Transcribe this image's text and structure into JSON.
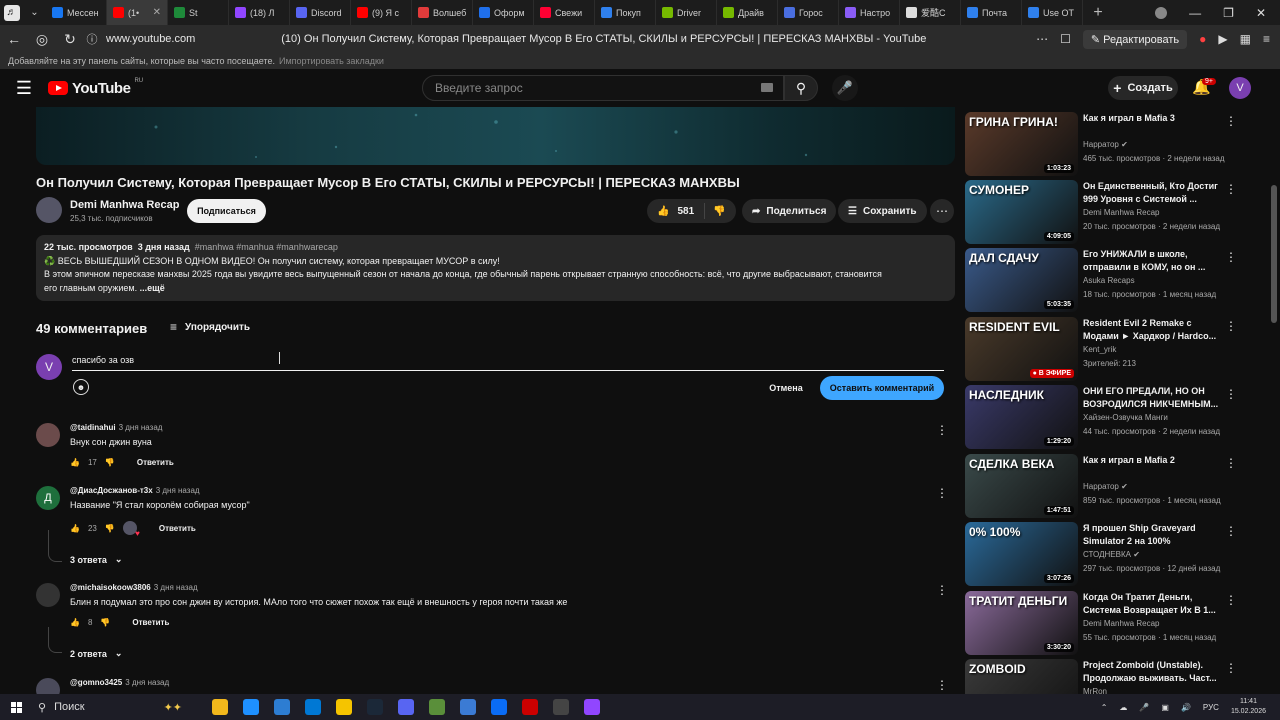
{
  "browser": {
    "tabs": [
      {
        "label": "Мессен",
        "color": "#1877f2"
      },
      {
        "label": "(1•",
        "color": "#ff0000",
        "active": true
      },
      {
        "label": "St",
        "color": "#1e8a3a"
      },
      {
        "label": "(18) Л",
        "color": "#9146ff"
      },
      {
        "label": "Discord",
        "color": "#5865f2"
      },
      {
        "label": "(9) Я с",
        "color": "#ff0000"
      },
      {
        "label": "Волшеб",
        "color": "#e23b3b"
      },
      {
        "label": "Оформ",
        "color": "#1f6feb"
      },
      {
        "label": "Свежи",
        "color": "#ff0033"
      },
      {
        "label": "Покуп",
        "color": "#2f80ed"
      },
      {
        "label": "Driver",
        "color": "#76b900"
      },
      {
        "label": "Драйв",
        "color": "#76b900"
      },
      {
        "label": "Горос",
        "color": "#4a6ee0"
      },
      {
        "label": "Настро",
        "color": "#8a5cf6"
      },
      {
        "label": "爱酷C",
        "color": "#dddddd"
      },
      {
        "label": "Почта",
        "color": "#2f80ed"
      },
      {
        "label": "Use OT",
        "color": "#2f80ed"
      }
    ],
    "url": "www.youtube.com",
    "page_title": "(10) Он Получил Систему, Которая Превращает Мусор В Его СТАТЫ, СКИЛЫ и РЕРСУРСЫ! | ПЕРЕСКАЗ МАНХВЫ - YouTube",
    "edit_label": "Редактировать",
    "bookmarks_hint": "Добавляйте на эту панель сайты, которые вы часто посещаете.",
    "bookmarks_import": "Импортировать закладки"
  },
  "youtube": {
    "logo_text": "YouTube",
    "region": "RU",
    "search_placeholder": "Введите запрос",
    "create_label": "Создать",
    "notif_count": "9+",
    "avatar_letter": "V"
  },
  "video": {
    "title": "Он Получил Систему, Которая Превращает Мусор В Его СТАТЫ, СКИЛЫ и РЕРСУРСЫ! | ПЕРЕСКАЗ МАНХВЫ",
    "channel": "Demi Manhwa Recap",
    "subs": "25,3 тыс. подписчиков",
    "subscribe": "Подписаться",
    "likes": "581",
    "share": "Поделиться",
    "save": "Сохранить",
    "desc_views": "22 тыс. просмотров",
    "desc_date": "3 дня назад",
    "desc_tags": "#manhwa #manhua #manhwarecap",
    "desc_line1": "♻️ ВЕСЬ ВЫШЕДШИЙ СЕЗОН В ОДНОМ ВИДЕО! Он получил систему, которая превращает МУСОР в силу!",
    "desc_line2": "В этом эпичном пересказе манхвы 2025 года вы увидите весь выпущенный сезон от начала до конца, где обычный парень открывает странную способность: всё, что другие выбрасывают, становится",
    "desc_line3": "его главным оружием.",
    "desc_more": "...ещё"
  },
  "comments": {
    "count_label": "49 комментариев",
    "sort_label": "Упорядочить",
    "my_avatar": "V",
    "draft": "спасибо за озв",
    "cancel": "Отмена",
    "submit": "Оставить комментарий",
    "items": [
      {
        "author": "@taidinahui",
        "time": "3 дня назад",
        "text": "Внук сон джин вуна",
        "likes": "17",
        "reply": "Ответить",
        "avatar_letter": "",
        "avatar_color": "#6b4b4b"
      },
      {
        "author": "@ДиасДосжанов-т3х",
        "time": "3 дня назад",
        "text": "Название \"Я стал королём собирая мусор\"",
        "likes": "23",
        "reply": "Ответить",
        "avatar_letter": "Д",
        "avatar_color": "#1e6f3c",
        "replies": "3 ответа"
      },
      {
        "author": "@michaisokoow3806",
        "time": "3 дня назад",
        "text": "Блин я подумал это про сон джин ву история. МАло того что сюжет похож так ещё и внешность у героя почти такая же",
        "likes": "8",
        "reply": "Ответить",
        "avatar_letter": "",
        "avatar_color": "#333333",
        "replies": "2 ответа"
      },
      {
        "author": "@gomno3425",
        "time": "3 дня назад",
        "avatar_letter": "",
        "avatar_color": "#4a4a5a"
      }
    ]
  },
  "recommendations": [
    {
      "title": "Как я играл в Mafia 3",
      "channel": "Нарратор",
      "meta": "465 тыс. просмотров · 2 недели назад",
      "duration": "1:03:23",
      "verified": true,
      "thumb_text": "ГРИНА ГРИНА!",
      "thumb_color": "#5a3a2a"
    },
    {
      "title": "Он Единственный, Кто Достиг 999 Уровня с Системой ...",
      "channel": "Demi Manhwa Recap",
      "meta": "20 тыс. просмотров · 2 недели назад",
      "duration": "4:09:05",
      "thumb_text": "СУМОНЕР",
      "thumb_color": "#2a6a8a"
    },
    {
      "title": "Его УНИЖАЛИ в школе, отправили в КОМУ, но он ...",
      "channel": "Asuka Recaps",
      "meta": "18 тыс. просмотров · 1 месяц назад",
      "duration": "5:03:35",
      "thumb_text": "ДАЛ СДАЧУ",
      "thumb_color": "#3a5a8a"
    },
    {
      "title": "Resident Evil 2 Remake с Модами ► Хардкор / Hardco...",
      "channel": "Kent_yrik",
      "meta": "Зрителей: 213",
      "live": "В ЭФИРЕ",
      "thumb_text": "RESIDENT EVIL",
      "thumb_color": "#4a3a2a"
    },
    {
      "title": "ОНИ ЕГО ПРЕДАЛИ, НО ОН ВОЗРОДИЛСЯ НИКЧЕМНЫМ...",
      "channel": "Хайзен-Озвучка Манги",
      "meta": "44 тыс. просмотров · 2 недели назад",
      "duration": "1:29:20",
      "thumb_text": "НАСЛЕДНИК",
      "thumb_color": "#3a3a6a"
    },
    {
      "title": "Как я играл в Mafia 2",
      "channel": "Нарратор",
      "meta": "859 тыс. просмотров · 1 месяц назад",
      "duration": "1:47:51",
      "verified": true,
      "thumb_text": "СДЕЛКА ВЕКА",
      "thumb_color": "#3a4a4a"
    },
    {
      "title": "Я прошел Ship Graveyard Simulator 2 на 100%",
      "channel": "СТОДНЕВКА",
      "meta": "297 тыс. просмотров · 12 дней назад",
      "duration": "3:07:26",
      "verified": true,
      "thumb_text": "0% 100%",
      "thumb_color": "#2a6a9a"
    },
    {
      "title": "Когда Он Тратит Деньги, Система Возвращает Их В 1...",
      "channel": "Demi Manhwa Recap",
      "meta": "55 тыс. просмотров · 1 месяц назад",
      "duration": "3:30:20",
      "thumb_text": "ТРАТИТ ДЕНЬГИ",
      "thumb_color": "#8a6a9a"
    },
    {
      "title": "Project Zomboid (Unstable). Продолжаю выживать. Част...",
      "channel": "MrRon",
      "meta": "",
      "thumb_text": "ZOMBOID",
      "thumb_color": "#3a3a3a"
    }
  ],
  "taskbar": {
    "search": "Поиск",
    "lang": "РУС",
    "time": "11:41",
    "date": "15.02.2026",
    "apps": [
      "#f2b81c",
      "#1e90ff",
      "#2d7dd2",
      "#0078d4",
      "#f5c400",
      "#1b2838",
      "#5865f2",
      "#5a8f3a",
      "#3b7bd4",
      "#0a6cf5",
      "#cc0000",
      "#444444",
      "#9146ff"
    ]
  }
}
